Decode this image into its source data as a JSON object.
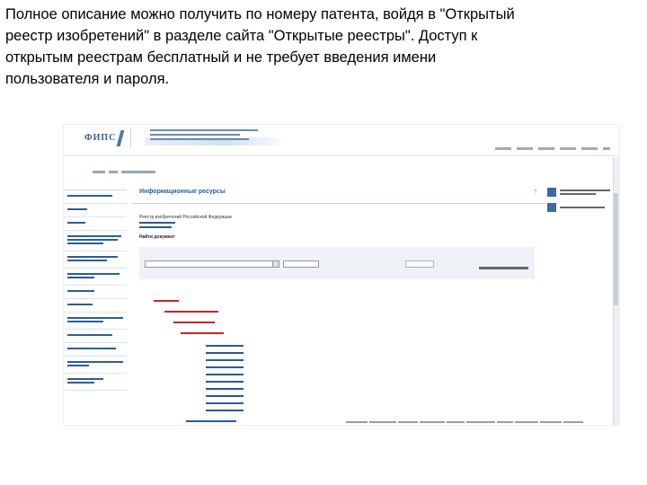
{
  "caption": {
    "line1": "Полное описание можно получить по номеру патента, войдя в \"Открытый",
    "line2": "реестр изобретений\" в разделе сайта \"Открытые реестры\". Доступ к",
    "line3": "открытым реестрам бесплатный и не требует введения имени",
    "line4": "пользователя и пароля."
  },
  "screenshot": {
    "logo_text": "ФИПС",
    "panel_title": "Информационные ресурсы",
    "registry_title": "Реестр изобретений Российской Федерации",
    "search_title": "Найти документ",
    "colors": {
      "brand": "#2c5c91",
      "link": "#2a5896",
      "range_link": "#c0282a"
    }
  }
}
